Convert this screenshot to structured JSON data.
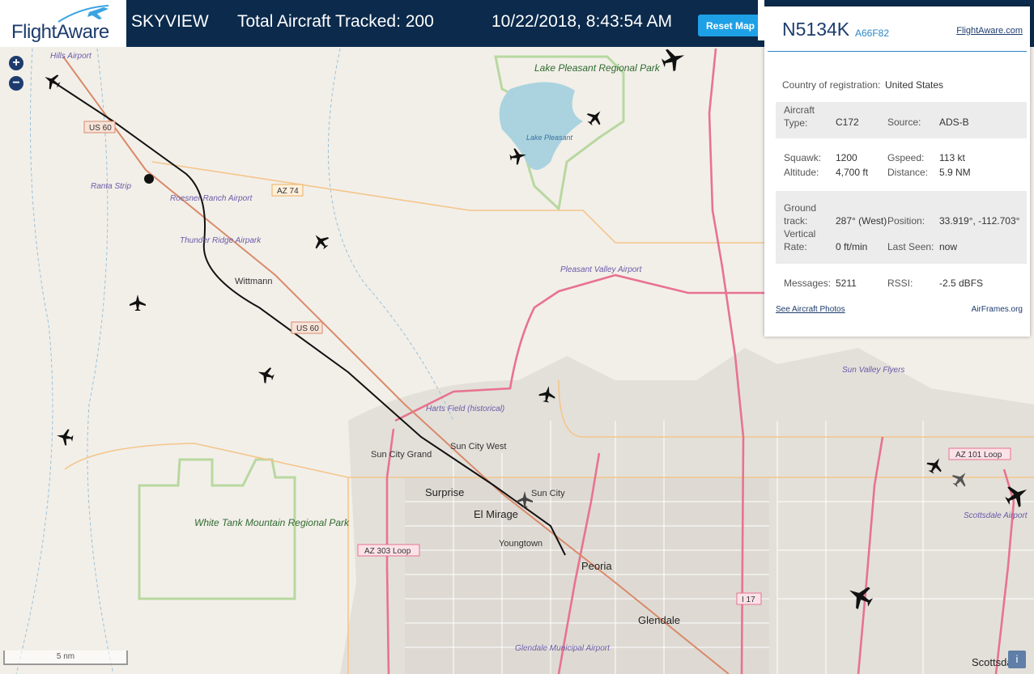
{
  "header": {
    "logo_text": "FlightAware",
    "app_name": "SKYVIEW",
    "aircraft_count": "Total Aircraft Tracked: 200",
    "datetime": "10/22/2018, 8:43:54 AM",
    "reset_label": "Reset Map"
  },
  "map": {
    "zoom_in": "+",
    "zoom_out": "−",
    "scale": "5 nm",
    "info": "i",
    "places": [
      "Hills Airport",
      "Ranta Strip",
      "Roesner Ranch Airport",
      "Thunder Ridge Airpark",
      "Wittmann",
      "Lake Pleasant Regional Park",
      "Lake Pleasant",
      "Pleasant Valley Airport",
      "Harts Field (historical)",
      "Sun City West",
      "Sun City Grand",
      "Surprise",
      "El Mirage",
      "Sun City",
      "Youngtown",
      "Peoria",
      "Glendale",
      "Glendale Municipal Airport",
      "White Tank Mountain Regional Park",
      "Sun Valley Flyers",
      "Scottsdale Airport",
      "Scottsdale"
    ],
    "roads": [
      "US 60",
      "AZ 74",
      "AZ 303 Loop",
      "AZ 101 Loop",
      "I 17"
    ],
    "colors": {
      "land": "#f2efe9",
      "water": "#aad3df",
      "park": "#c8e6b0",
      "highway": "#e8738f",
      "track": "#111111"
    }
  },
  "panel": {
    "registration": "N5134K",
    "hex": "A66F82",
    "site_link": "FlightAware.com",
    "country_label": "Country of registration:",
    "country": "United States",
    "aircraft_type_label": "Aircraft Type:",
    "aircraft_type": "C172",
    "source_label": "Source:",
    "source": "ADS-B",
    "squawk_label": "Squawk:",
    "squawk": "1200",
    "gspeed_label": "Gspeed:",
    "gspeed": "113 kt",
    "altitude_label": "Altitude:",
    "altitude": "4,700 ft",
    "distance_label": "Distance:",
    "distance": "5.9 NM",
    "ground_track_label": "Ground track:",
    "ground_track": "287° (West)",
    "position_label": "Position:",
    "position": "33.919°, -112.703°",
    "vertical_rate_label": "Vertical Rate:",
    "vertical_rate": "0 ft/min",
    "last_seen_label": "Last Seen:",
    "last_seen": "now",
    "messages_label": "Messages:",
    "messages": "5211",
    "rssi_label": "RSSI:",
    "rssi": "-2.5 dBFS",
    "photos_link": "See Aircraft Photos",
    "airframes_link": "AirFrames.org"
  }
}
